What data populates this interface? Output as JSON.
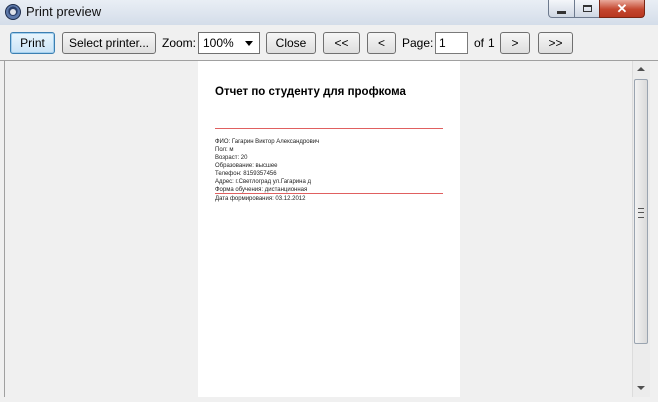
{
  "window": {
    "title": "Print preview",
    "close_glyph": "✕"
  },
  "toolbar": {
    "print_label": "Print",
    "select_printer_label": "Select printer...",
    "zoom_label": "Zoom:",
    "zoom_value": "100%",
    "close_label": "Close",
    "first_label": "<<",
    "prev_label": "<",
    "page_label": "Page:",
    "page_value": "1",
    "of_label": "of",
    "total_pages": "1",
    "next_label": ">",
    "last_label": ">>"
  },
  "report": {
    "title": "Отчет по студенту для профкома",
    "lines": [
      "ФИО: Гагарин Виктор Александрович",
      "Пол: м",
      "Возраст: 20",
      "Образование: высшее",
      "Телефон: 8159357456",
      "Адрес: г.Светлоград ул.Гагарина д",
      "Форма обучения: дистанционная"
    ],
    "date_line": "Дата формирования: 03.12.2012"
  },
  "colors": {
    "accent_rule": "#e06060",
    "close_button": "#c4472f"
  }
}
